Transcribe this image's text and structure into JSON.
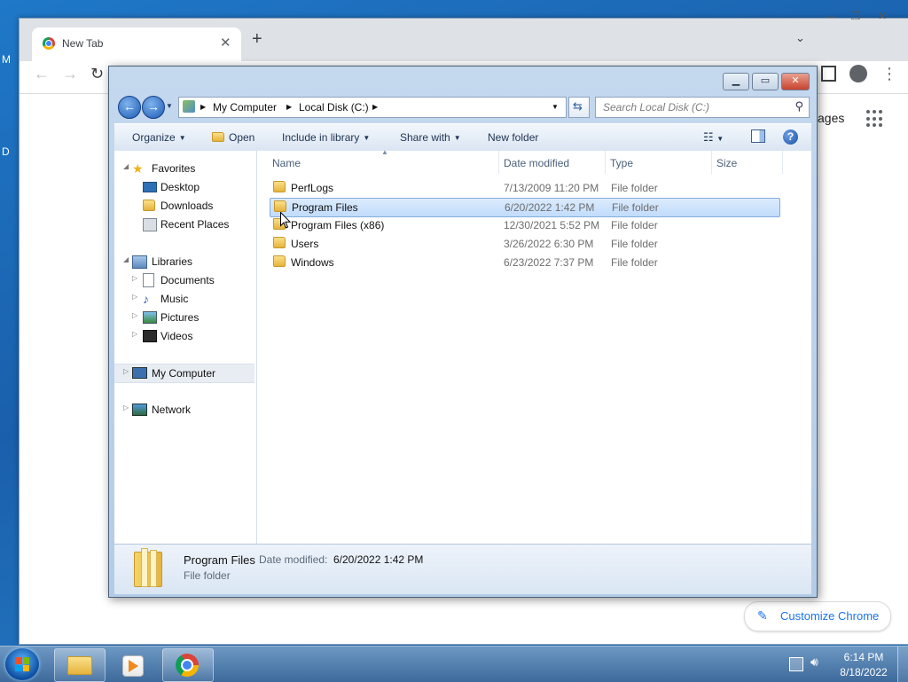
{
  "desktop": {
    "edge_glyph_top": "M",
    "edge_glyph_mid": "D"
  },
  "chrome": {
    "tab_title": "New Tab",
    "tab_close": "✕",
    "new_tab": "+",
    "tab_search": "⌄",
    "back": "←",
    "forward": "→",
    "reload": "↻",
    "menu": "⋮",
    "images_link": "ages",
    "customize_label": "Customize Chrome",
    "customize_icon": "✎"
  },
  "explorer": {
    "breadcrumb": [
      "My Computer",
      "Local Disk (C:)"
    ],
    "search_placeholder": "Search Local Disk (C:)",
    "commands": {
      "organize": "Organize",
      "open": "Open",
      "include_in_library": "Include in library",
      "share_with": "Share with",
      "new_folder": "New folder"
    },
    "nav": {
      "favorites": "Favorites",
      "desktop": "Desktop",
      "downloads": "Downloads",
      "recent_places": "Recent Places",
      "libraries": "Libraries",
      "documents": "Documents",
      "music": "Music",
      "pictures": "Pictures",
      "videos": "Videos",
      "my_computer": "My Computer",
      "network": "Network"
    },
    "columns": {
      "name": "Name",
      "date_modified": "Date modified",
      "type": "Type",
      "size": "Size"
    },
    "files": [
      {
        "name": "PerfLogs",
        "date": "7/13/2009 11:20 PM",
        "type": "File folder"
      },
      {
        "name": "Program Files",
        "date": "6/20/2022 1:42 PM",
        "type": "File folder"
      },
      {
        "name": "Program Files (x86)",
        "date": "12/30/2021 5:52 PM",
        "type": "File folder"
      },
      {
        "name": "Users",
        "date": "3/26/2022 6:30 PM",
        "type": "File folder"
      },
      {
        "name": "Windows",
        "date": "6/23/2022 7:37 PM",
        "type": "File folder"
      }
    ],
    "selected_index": 1,
    "details": {
      "name": "Program Files",
      "date_label": "Date modified:",
      "date_value": "6/20/2022 1:42 PM",
      "type": "File folder"
    }
  },
  "taskbar": {
    "time": "6:14 PM",
    "date": "8/18/2022"
  },
  "colors": {
    "explorer_frame": "#b4cbe6",
    "selection": "#c1dcfc",
    "chrome_accent": "#1a73e8",
    "taskbar": "#3d6a9c"
  }
}
